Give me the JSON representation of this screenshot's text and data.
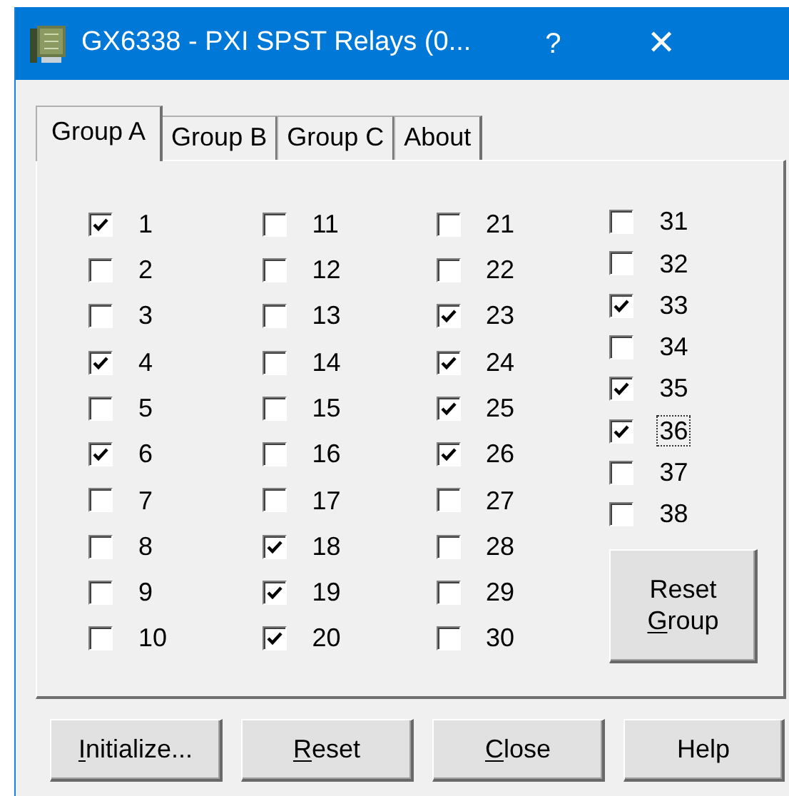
{
  "window": {
    "title": "GX6338 - PXI SPST Relays (0...",
    "help_glyph": "?",
    "close_glyph": "✕"
  },
  "tabs": [
    {
      "label": "Group A",
      "selected": true
    },
    {
      "label": "Group B",
      "selected": false
    },
    {
      "label": "Group C",
      "selected": false
    },
    {
      "label": "About",
      "selected": false
    }
  ],
  "relay_columns": [
    [
      {
        "label": "1",
        "checked": true,
        "focused": false
      },
      {
        "label": "2",
        "checked": false,
        "focused": false
      },
      {
        "label": "3",
        "checked": false,
        "focused": false
      },
      {
        "label": "4",
        "checked": true,
        "focused": false
      },
      {
        "label": "5",
        "checked": false,
        "focused": false
      },
      {
        "label": "6",
        "checked": true,
        "focused": false
      },
      {
        "label": "7",
        "checked": false,
        "focused": false
      },
      {
        "label": "8",
        "checked": false,
        "focused": false
      },
      {
        "label": "9",
        "checked": false,
        "focused": false
      },
      {
        "label": "10",
        "checked": false,
        "focused": false
      }
    ],
    [
      {
        "label": "11",
        "checked": false,
        "focused": false
      },
      {
        "label": "12",
        "checked": false,
        "focused": false
      },
      {
        "label": "13",
        "checked": false,
        "focused": false
      },
      {
        "label": "14",
        "checked": false,
        "focused": false
      },
      {
        "label": "15",
        "checked": false,
        "focused": false
      },
      {
        "label": "16",
        "checked": false,
        "focused": false
      },
      {
        "label": "17",
        "checked": false,
        "focused": false
      },
      {
        "label": "18",
        "checked": true,
        "focused": false
      },
      {
        "label": "19",
        "checked": true,
        "focused": false
      },
      {
        "label": "20",
        "checked": true,
        "focused": false
      }
    ],
    [
      {
        "label": "21",
        "checked": false,
        "focused": false
      },
      {
        "label": "22",
        "checked": false,
        "focused": false
      },
      {
        "label": "23",
        "checked": true,
        "focused": false
      },
      {
        "label": "24",
        "checked": true,
        "focused": false
      },
      {
        "label": "25",
        "checked": true,
        "focused": false
      },
      {
        "label": "26",
        "checked": true,
        "focused": false
      },
      {
        "label": "27",
        "checked": false,
        "focused": false
      },
      {
        "label": "28",
        "checked": false,
        "focused": false
      },
      {
        "label": "29",
        "checked": false,
        "focused": false
      },
      {
        "label": "30",
        "checked": false,
        "focused": false
      }
    ],
    [
      {
        "label": "31",
        "checked": false,
        "focused": false
      },
      {
        "label": "32",
        "checked": false,
        "focused": false
      },
      {
        "label": "33",
        "checked": true,
        "focused": false
      },
      {
        "label": "34",
        "checked": false,
        "focused": false
      },
      {
        "label": "35",
        "checked": true,
        "focused": false
      },
      {
        "label": "36",
        "checked": true,
        "focused": true
      },
      {
        "label": "37",
        "checked": false,
        "focused": false
      },
      {
        "label": "38",
        "checked": false,
        "focused": false
      }
    ]
  ],
  "reset_group_button": {
    "lines": [
      "Reset",
      "Group"
    ],
    "last_line_first_letter_underlined": true
  },
  "buttons": [
    {
      "label": "Initialize...",
      "first_letter_underlined": true
    },
    {
      "label": "Reset",
      "first_letter_underlined": true
    },
    {
      "label": "Close",
      "first_letter_underlined": true
    },
    {
      "label": "Help",
      "first_letter_underlined": false
    }
  ]
}
